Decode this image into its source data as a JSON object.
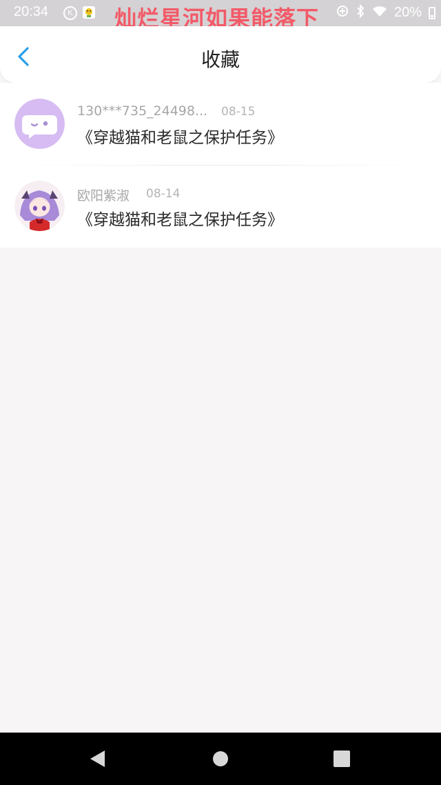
{
  "status_bar": {
    "time": "20:34",
    "banner": "灿烂星河如果能落下",
    "battery": "20%",
    "icons": [
      "k-icon",
      "app-notification-icon",
      "data-saver-icon",
      "bluetooth-icon",
      "wifi-icon",
      "battery-icon"
    ]
  },
  "header": {
    "title": "收藏",
    "back_icon": "chevron-left-icon"
  },
  "favorites": [
    {
      "username": "130***735_24498...",
      "date": "08-15",
      "title": "《穿越猫和老鼠之保护任务》",
      "avatar": "chat-bubble-avatar"
    },
    {
      "username": "欧阳紫淑",
      "date": "08-14",
      "title": "《穿越猫和老鼠之保护任务》",
      "avatar": "anime-girl-avatar"
    }
  ],
  "nav_bar": {
    "icons": [
      "nav-back-icon",
      "nav-home-icon",
      "nav-recents-icon"
    ]
  },
  "colors": {
    "accent": "#2a9ee8",
    "banner": "#f25a68",
    "avatar_bg": "#d6bcf2"
  }
}
